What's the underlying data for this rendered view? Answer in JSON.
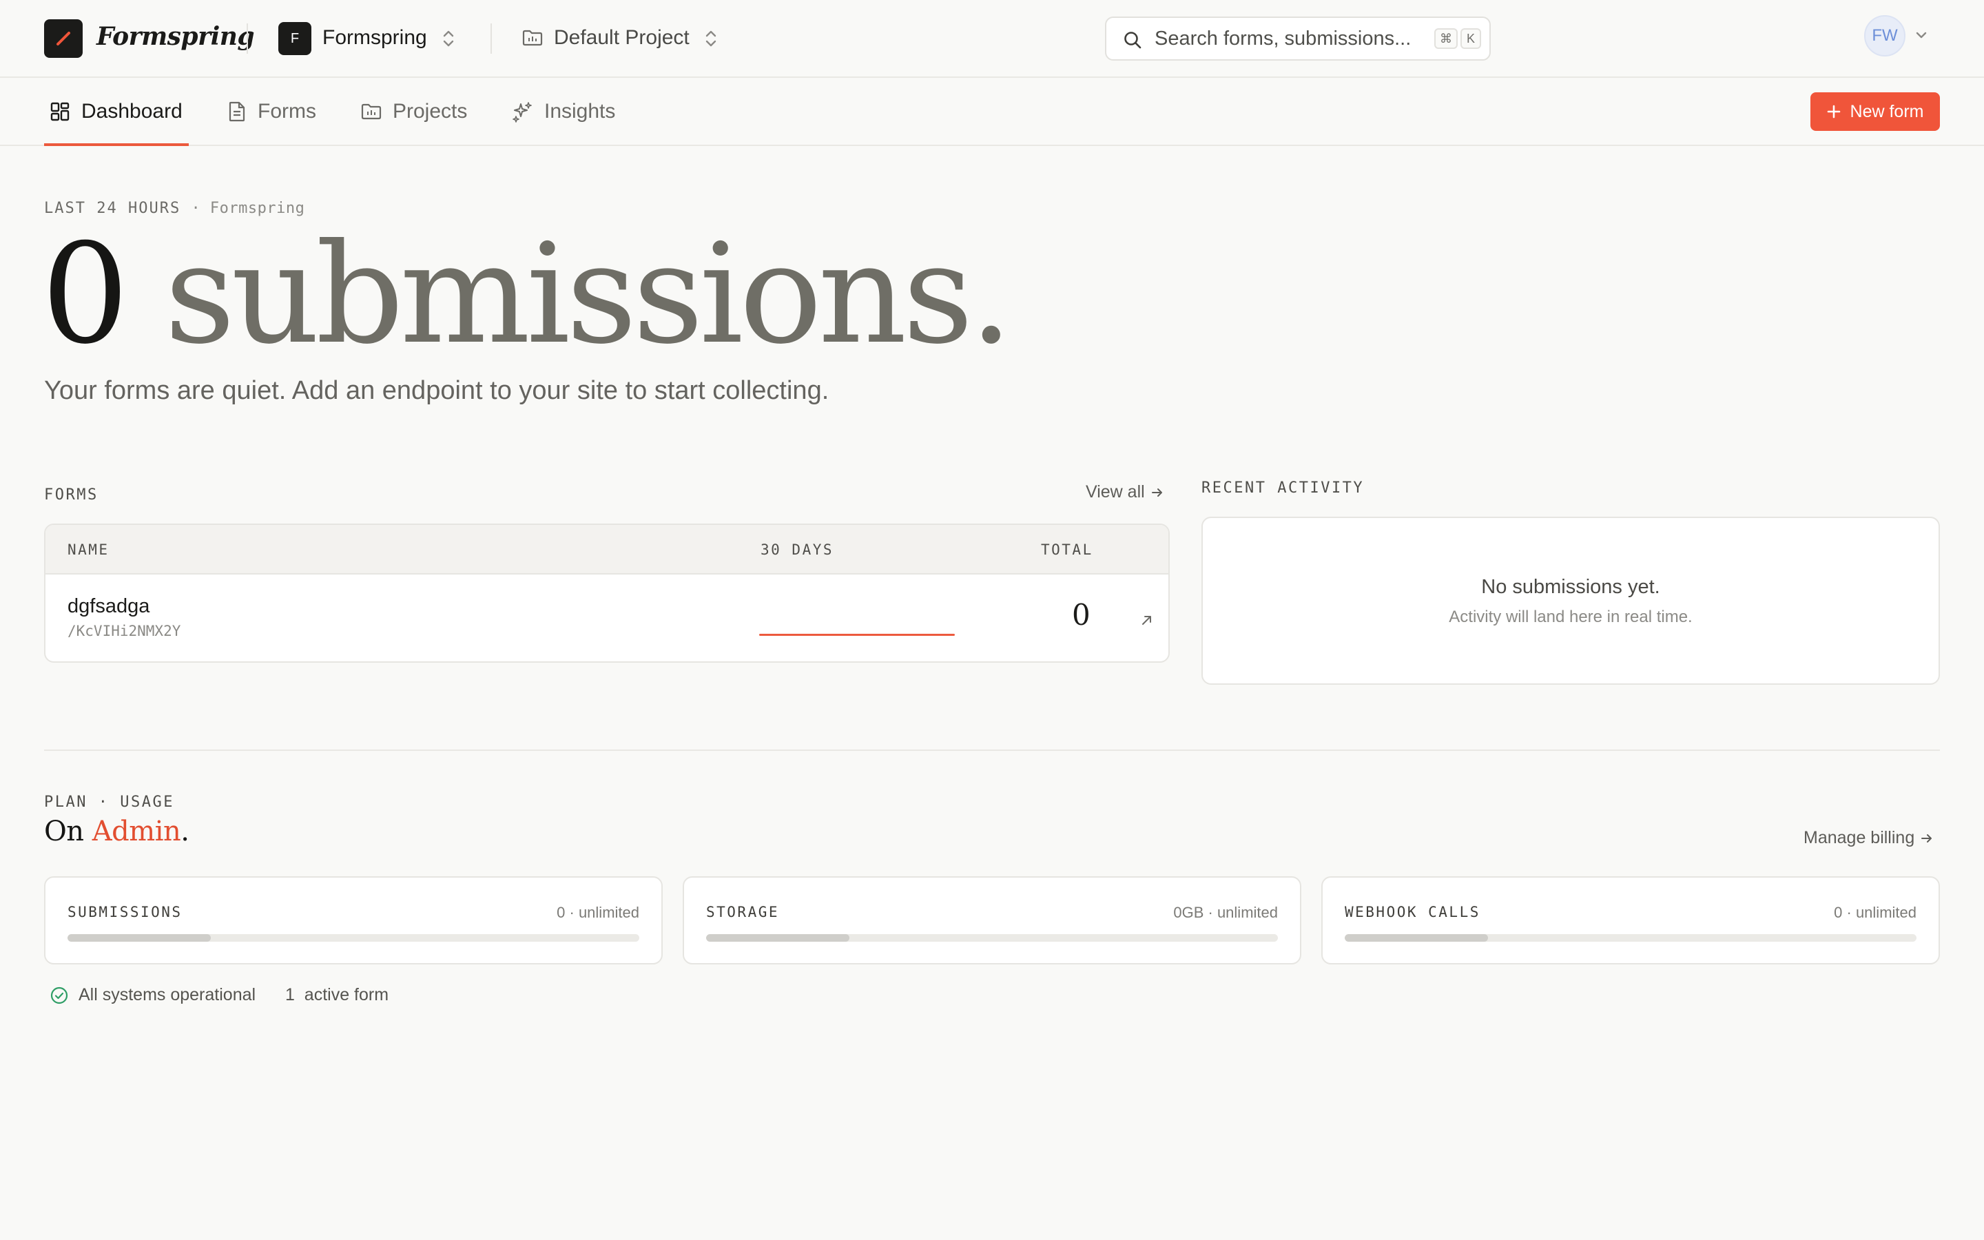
{
  "header": {
    "brand": "Formspring",
    "workspace": {
      "initial": "F",
      "name": "Formspring"
    },
    "project": {
      "name": "Default Project"
    },
    "search": {
      "placeholder": "Search forms, submissions...",
      "shortcut_mod": "⌘",
      "shortcut_key": "K"
    },
    "user": {
      "initials": "FW"
    }
  },
  "nav": {
    "tabs": [
      {
        "label": "Dashboard",
        "icon": "dashboard-grid-icon",
        "active": true
      },
      {
        "label": "Forms",
        "icon": "document-icon",
        "active": false
      },
      {
        "label": "Projects",
        "icon": "folder-icon",
        "active": false
      },
      {
        "label": "Insights",
        "icon": "sparkles-icon",
        "active": false
      }
    ],
    "new_form_label": "New form"
  },
  "hero": {
    "eyebrow": "LAST 24 HOURS",
    "eyebrow_sub": "· Formspring",
    "count": "0",
    "count_suffix": "submissions.",
    "lead": "Your forms are quiet. Add an endpoint to your site to start collecting."
  },
  "forms": {
    "label": "FORMS",
    "view_all": "View all",
    "columns": [
      "NAME",
      "30 DAYS",
      "TOTAL"
    ],
    "rows": [
      {
        "name": "dgfsadga",
        "slug": "/KcVIHi2NMX2Y",
        "total": "0"
      }
    ]
  },
  "activity": {
    "label": "RECENT ACTIVITY",
    "empty_title": "No submissions yet.",
    "empty_sub": "Activity will land here in real time."
  },
  "plan": {
    "label": "PLAN · USAGE",
    "prefix": "On",
    "name": "Admin",
    "suffix": ".",
    "manage_billing": "Manage billing",
    "usage": [
      {
        "label": "SUBMISSIONS",
        "value": "0 · unlimited",
        "fill_fraction": 0.25
      },
      {
        "label": "STORAGE",
        "value": "0GB · unlimited",
        "fill_fraction": 0.25
      },
      {
        "label": "WEBHOOK CALLS",
        "value": "0 · unlimited",
        "fill_fraction": 0.25
      }
    ]
  },
  "footer": {
    "status": "All systems operational",
    "active_forms": "1  active form"
  },
  "colors": {
    "accent": "#f0553a",
    "brand_dark": "#1b1b19",
    "background": "#f9f9f7",
    "status_ok": "#2f9e66"
  }
}
